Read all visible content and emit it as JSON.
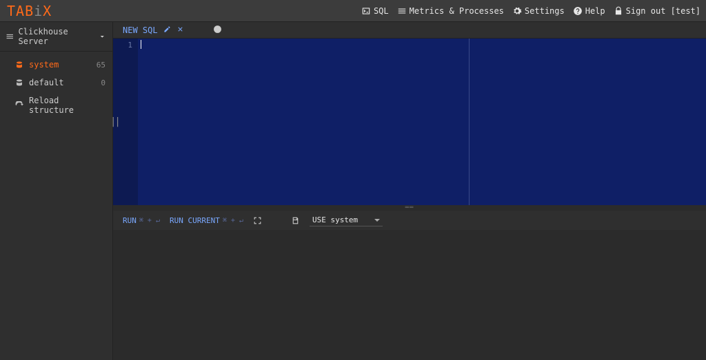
{
  "header": {
    "logo_main": "TAB",
    "logo_accent": "i",
    "logo_tail": "X",
    "nav": {
      "sql": "SQL",
      "metrics": "Metrics & Processes",
      "settings": "Settings",
      "help": "Help",
      "signout": "Sign out [test]"
    }
  },
  "sidebar": {
    "server_label": "Clickhouse Server",
    "items": [
      {
        "label": "system",
        "count": "65",
        "selected": true,
        "icon": "database-icon"
      },
      {
        "label": "default",
        "count": "0",
        "selected": false,
        "icon": "database-icon"
      },
      {
        "label": "Reload structure",
        "count": "",
        "selected": false,
        "icon": "refresh-icon"
      }
    ]
  },
  "tabbar": {
    "active_tab": "NEW SQL"
  },
  "editor": {
    "line_numbers": [
      "1"
    ],
    "content": ""
  },
  "runbar": {
    "run": "RUN",
    "run_hint": "⌘ + ↵",
    "run_current": "RUN CURRENT",
    "run_current_hint": "⌘ + ↵",
    "use_label": "USE system"
  }
}
